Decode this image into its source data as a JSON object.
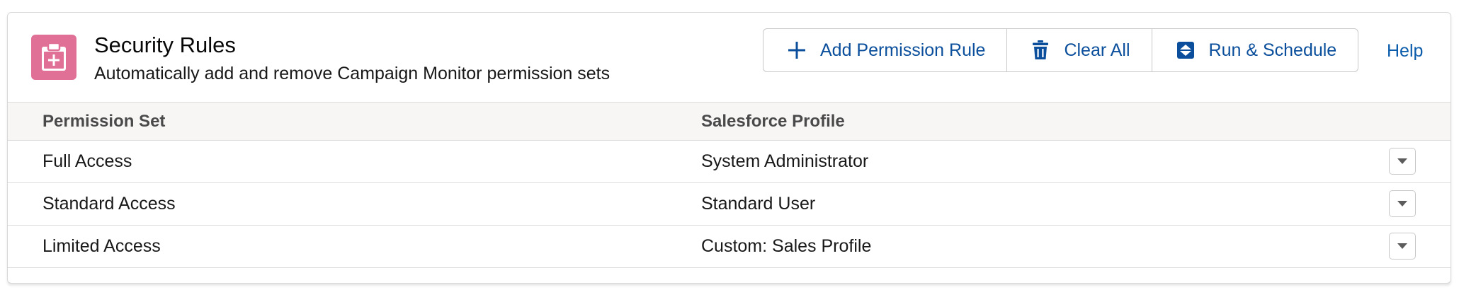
{
  "colors": {
    "icon_bg": "#e07096",
    "accent": "#0b5cab",
    "button_text": "#0b4f9c"
  },
  "header": {
    "icon": "clipboard-plus-icon",
    "title": "Security Rules",
    "subtitle": "Automatically add and remove Campaign Monitor permission sets"
  },
  "toolbar": {
    "add_label": "Add Permission Rule",
    "add_icon": "plus-icon",
    "clear_label": "Clear All",
    "clear_icon": "trash-icon",
    "run_label": "Run & Schedule",
    "run_icon": "sort-arrows-icon",
    "help_label": "Help"
  },
  "table": {
    "columns": [
      "Permission Set",
      "Salesforce Profile"
    ],
    "rows": [
      {
        "permission_set": "Full Access",
        "profile": "System Administrator",
        "menu_icon": "chevron-down-icon"
      },
      {
        "permission_set": "Standard Access",
        "profile": "Standard User",
        "menu_icon": "chevron-down-icon"
      },
      {
        "permission_set": "Limited Access",
        "profile": "Custom: Sales Profile",
        "menu_icon": "chevron-down-icon"
      }
    ]
  }
}
